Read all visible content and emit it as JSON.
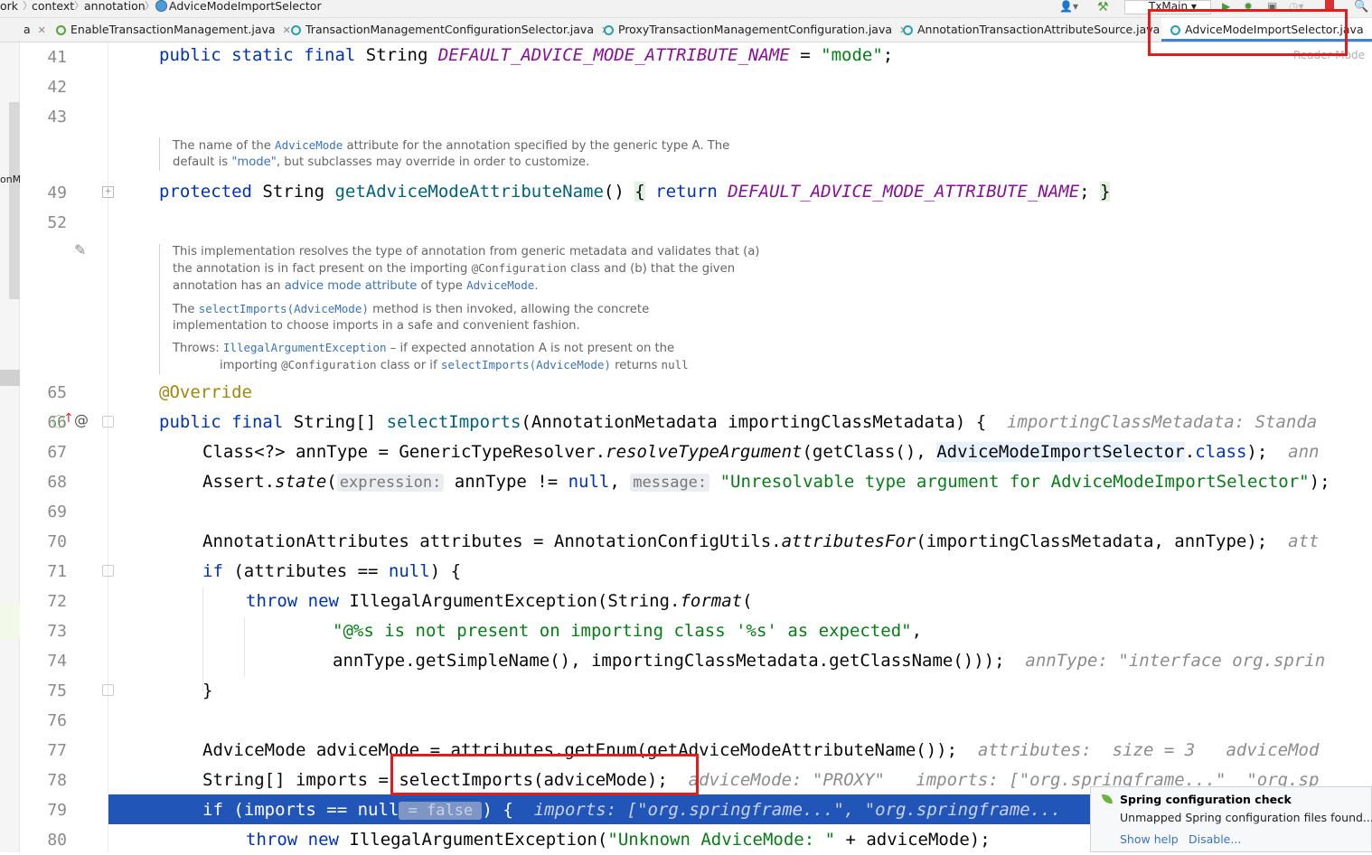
{
  "breadcrumb": {
    "items": [
      "ork",
      "context",
      "annotation",
      "AdviceModeImportSelector"
    ]
  },
  "toolbar": {
    "run_config": "TxMain"
  },
  "tabs": [
    {
      "label": "a"
    },
    {
      "label": "EnableTransactionManagement.java"
    },
    {
      "label": "TransactionManagementConfigurationSelector.java"
    },
    {
      "label": "ProxyTransactionManagementConfiguration.java"
    },
    {
      "label": "AnnotationTransactionAttributeSource.java"
    },
    {
      "label": "AdviceModeImportSelector.java",
      "active": true
    }
  ],
  "reader_mode": "Reader Mode",
  "left_strip_text": "onM",
  "line_numbers": [
    "41",
    "42",
    "43",
    "49",
    "52",
    "65",
    "66",
    "67",
    "68",
    "69",
    "70",
    "71",
    "72",
    "73",
    "74",
    "75",
    "76",
    "77",
    "78",
    "79",
    "80"
  ],
  "doc1": {
    "t1": "The name of the ",
    "ref1": "AdviceMode",
    "t2": " attribute for the annotation specified by the generic type A. The",
    "t3": "default is ",
    "ref2": "\"mode\"",
    "t4": ", but subclasses may override in order to customize."
  },
  "doc2": {
    "p1a": "This implementation resolves the type of annotation from generic metadata and validates that (a)",
    "p1b": "the annotation is in fact present on the importing ",
    "p1b_code": "@Configuration",
    "p1b2": " class and (b) that the given",
    "p1c": "annotation has an ",
    "p1c_ref": "advice mode attribute",
    "p1c2": " of type ",
    "p1c_ref2": "AdviceMode",
    "p1c3": ".",
    "p2a": "The ",
    "p2a_ref": "selectImports(AdviceMode)",
    "p2a2": " method is then invoked, allowing the concrete",
    "p2b": "implementation to choose imports in a safe and convenient fashion.",
    "p3a": "Throws: ",
    "p3a_ref": "IllegalArgumentException",
    "p3a2": " – if expected annotation A is not present on the",
    "p3b": "importing ",
    "p3b_code": "@Configuration",
    "p3b2": " class or if ",
    "p3b_ref": "selectImports(AdviceMode)",
    "p3b3": " returns ",
    "p3b_code2": "null"
  },
  "code": {
    "l41": {
      "kw": "public static final ",
      "type": "String ",
      "name": "DEFAULT_ADVICE_MODE_ATTRIBUTE_NAME",
      "eq": " = ",
      "str": "\"mode\"",
      "end": ";"
    },
    "l49": {
      "kw": "protected ",
      "type": "String ",
      "fn": "getAdviceModeAttributeName",
      "paren": "()",
      "sp": " ",
      "ob": "{",
      "ret": " return ",
      "name": "DEFAULT_ADVICE_MODE_ATTRIBUTE_NAME",
      "semi": "; ",
      "cb": "}"
    },
    "l65": "@Override",
    "l66": {
      "kw": "public final ",
      "type": "String[] ",
      "fn": "selectImports",
      "rest": "(AnnotationMetadata importingClassMetadata) {",
      "hint": "  importingClassMetadata: Standa"
    },
    "l67": {
      "a": "Class<?> annType = GenericTypeResolver.",
      "i": "resolveTypeArgument",
      "b": "(getClass(), ",
      "hl": "AdviceModeImportSelector",
      "c": ".",
      "kw": "class",
      "d": ");",
      "hint": "  ann"
    },
    "l68": {
      "a": "Assert.",
      "i": "state",
      "b": "(",
      "p1": "expression:",
      "c": " annType != ",
      "kw": "null",
      "d": ", ",
      "p2": "message:",
      "str": " \"Unresolvable type argument for AdviceModeImportSelector\"",
      "e": ");"
    },
    "l70": {
      "a": "AnnotationAttributes attributes = AnnotationConfigUtils.",
      "i": "attributesFor",
      "b": "(importingClassMetadata, annType);",
      "hint": "  att"
    },
    "l71": {
      "kw": "if",
      "a": " (attributes == ",
      "kw2": "null",
      "b": ") {"
    },
    "l72": {
      "kw": "throw new ",
      "a": "IllegalArgumentException(String.",
      "i": "format",
      "b": "("
    },
    "l73": {
      "str": "\"@%s is not present on importing class '%s' as expected\"",
      "a": ","
    },
    "l74": {
      "a": "annType.getSimpleName(), importingClassMetadata.getClassName()));",
      "hint": "  annType: \"interface org.sprin"
    },
    "l75": "}",
    "l77": {
      "a": "AdviceMode adviceMode = attributes.getEnum(getAdviceModeAttributeName());",
      "hint": "  attributes:  size = 3   adviceMod"
    },
    "l78": {
      "a": "String[] imports = selectImports(adviceMode);",
      "hint": "  adviceMode: \"PROXY\"   imports: [\"org.springframe...\"  \"org.sp"
    },
    "l79": {
      "a": "if (imports == null",
      "inl": " = false ",
      "b": ") {",
      "hint": "  imports: [\"org.springframe...\", \"org.springframe..."
    },
    "l80": {
      "kw": "throw new ",
      "a": "IllegalArgumentException(",
      "str": "\"Unknown AdviceMode: \"",
      "b": " + adviceMode);"
    }
  },
  "notification": {
    "title": "Spring configuration check",
    "body": "Unmapped Spring configuration files found....",
    "show_help": "Show help",
    "disable": "Disable..."
  },
  "colors": {
    "keyword": "#0033b3",
    "string": "#067d17",
    "constant": "#871094",
    "exec_line": "#2255b8",
    "highlight_box": "#e51c1c"
  }
}
